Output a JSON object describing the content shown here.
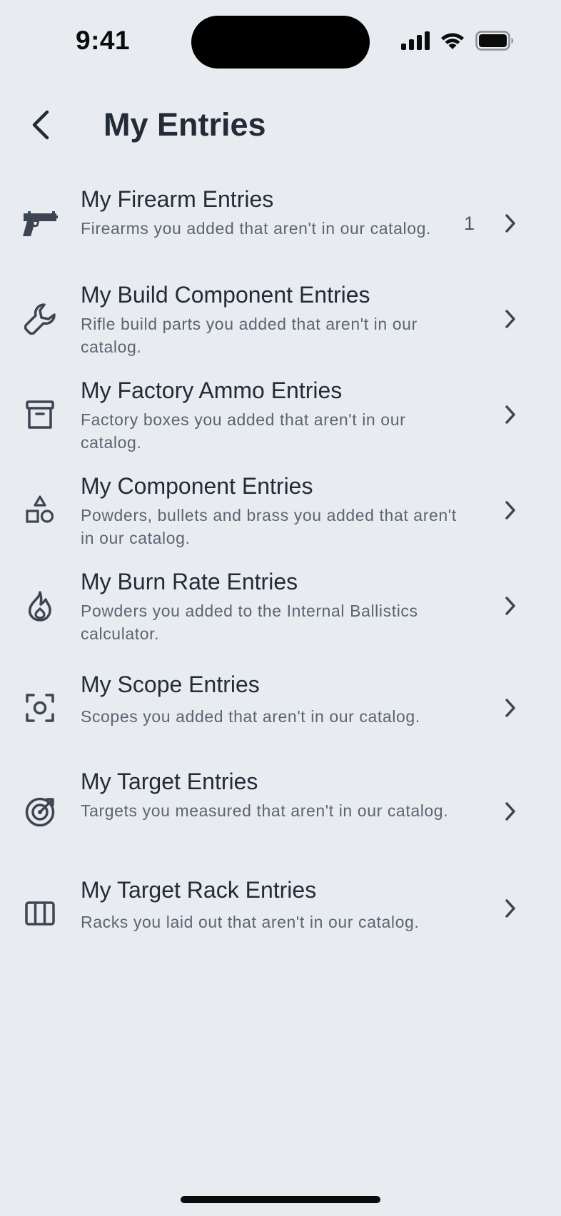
{
  "status_bar": {
    "time": "9:41"
  },
  "header": {
    "title": "My Entries"
  },
  "entries": [
    {
      "title": "My Firearm Entries",
      "subtitle": "Firearms you added that aren't in our catalog.",
      "count": "1",
      "icon": "pistol-icon"
    },
    {
      "title": "My Build Component Entries",
      "subtitle": "Rifle build parts you added that aren't in our catalog.",
      "count": "",
      "icon": "wrench-icon"
    },
    {
      "title": "My Factory Ammo Entries",
      "subtitle": "Factory boxes you added that aren't in our catalog.",
      "count": "",
      "icon": "archive-box-icon"
    },
    {
      "title": "My Component Entries",
      "subtitle": "Powders, bullets and brass you added that aren't in our catalog.",
      "count": "",
      "icon": "shapes-icon"
    },
    {
      "title": "My Burn Rate Entries",
      "subtitle": "Powders you added to the Internal Ballistics calculator.",
      "count": "",
      "icon": "flame-icon"
    },
    {
      "title": "My Scope Entries",
      "subtitle": "Scopes you added that aren't in our catalog.",
      "count": "",
      "icon": "scope-focus-icon"
    },
    {
      "title": "My Target Entries",
      "subtitle": "Targets you measured that aren't in our catalog.",
      "count": "",
      "icon": "target-icon"
    },
    {
      "title": "My Target Rack Entries",
      "subtitle": "Racks you laid out that aren't in our catalog.",
      "count": "",
      "icon": "rack-columns-icon"
    }
  ],
  "colors": {
    "background": "#e8ecf0",
    "text_primary": "#232b38",
    "text_secondary": "#5b6472",
    "icon": "#3d4553"
  }
}
